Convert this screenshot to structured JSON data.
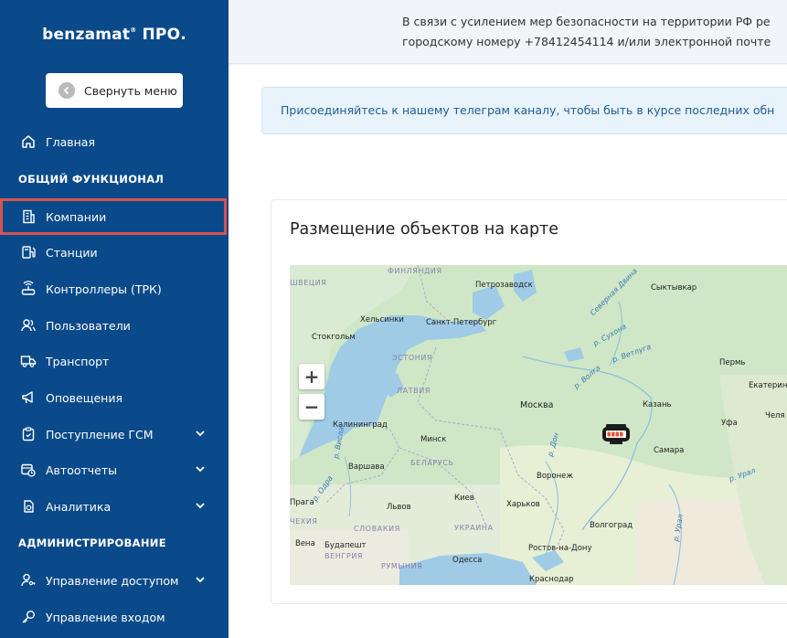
{
  "brand": {
    "name": "benzamat",
    "reg": "®",
    "suffix": " ПРО."
  },
  "sidebar": {
    "collapse_label": "Свернуть меню",
    "sections": [
      "ОБЩИЙ ФУНКЦИОНАЛ",
      "АДМИНИСТРИРОВАНИЕ"
    ],
    "items": [
      {
        "label": "Главная",
        "icon": "home-icon"
      },
      {
        "label": "Компании",
        "icon": "building-icon",
        "active": true
      },
      {
        "label": "Станции",
        "icon": "fuel-station-icon"
      },
      {
        "label": "Контроллеры (ТРК)",
        "icon": "router-icon"
      },
      {
        "label": "Пользователи",
        "icon": "users-icon"
      },
      {
        "label": "Транспорт",
        "icon": "truck-icon"
      },
      {
        "label": "Оповещения",
        "icon": "megaphone-icon"
      },
      {
        "label": "Поступление ГСМ",
        "icon": "clipboard-icon",
        "expandable": true
      },
      {
        "label": "Автоотчеты",
        "icon": "calendar-clock-icon",
        "expandable": true
      },
      {
        "label": "Аналитика",
        "icon": "analytics-icon",
        "expandable": true
      },
      {
        "label": "Управление доступом",
        "icon": "user-key-icon",
        "expandable": true
      },
      {
        "label": "Управление входом",
        "icon": "key-icon"
      }
    ]
  },
  "topbar": {
    "line1": "В связи с усилением мер безопасности на территории РФ ре",
    "line2": "городскому номеру +78412454114 и/или электронной почте"
  },
  "alert": {
    "text": "Присоединяйтесь к нашему телеграм каналу, чтобы быть в курсе последних обн"
  },
  "map_card": {
    "title": "Размещение объектов на карте",
    "zoom_in": "+",
    "zoom_out": "−",
    "labels": {
      "finland": "ФИНЛЯНДИЯ",
      "sweden": "ШВЕЦИЯ",
      "estonia": "ЭСТОНИЯ",
      "latvia": "ЛАТВИЯ",
      "belarus": "БЕЛАРУСЬ",
      "ukraine": "УКРАИНА",
      "slovakia": "СЛОВАКИЯ",
      "hungary": "ВЕНГРИЯ",
      "romania": "РУМЫНИЯ",
      "czechia": "ЧЕХИЯ",
      "petrozavodsk": "Петрозаводск",
      "syktyvkar": "Сыктывкар",
      "helsinki": "Хельсинки",
      "spb": "Санкт-Петербург",
      "stockholm": "Стокгольм",
      "perm": "Пермь",
      "ekaterinburg": "Екатеринб",
      "moscow": "Москва",
      "kazan": "Казань",
      "kaliningrad": "Калининград",
      "minsk": "Минск",
      "ufa": "Уфа",
      "chel": "Челя",
      "samara": "Самара",
      "warsaw": "Варшава",
      "voronezh": "Воронеж",
      "kiev": "Киев",
      "kharkov": "Харьков",
      "lvov": "Львов",
      "prague": "Прага",
      "vienna": "Вена",
      "budapest": "Будапешт",
      "volgograd": "Волгоград",
      "rostov": "Ростов-на-Дону",
      "odessa": "Одесса",
      "krasnodar": "Краснодар",
      "r_dvina": "Северная Двина",
      "r_suhona": "р. Сухона",
      "r_vetluga": "р. Ветлуга",
      "r_volga": "р. Волга",
      "r_don": "р. Дон",
      "r_ural": "р. Урал",
      "r_ural2": "р. Урал",
      "r_visla": "р. Висла",
      "r_oder": "р. Одра"
    }
  }
}
